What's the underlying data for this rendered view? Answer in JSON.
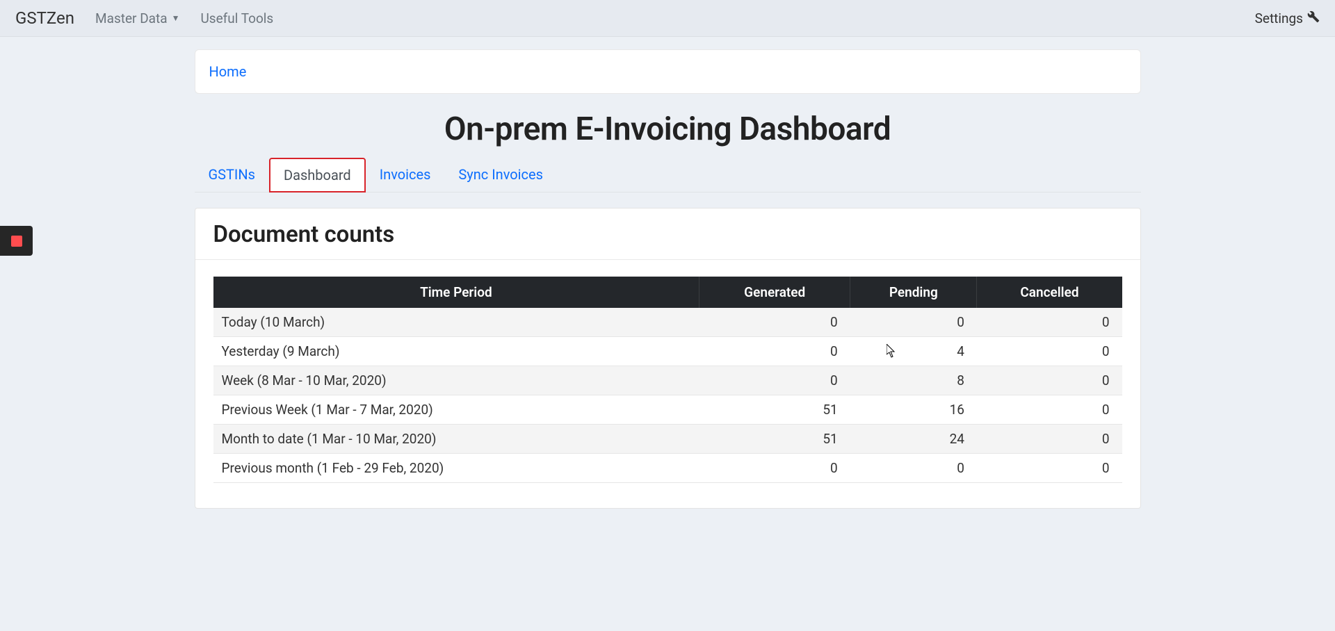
{
  "navbar": {
    "brand": "GSTZen",
    "master_data_label": "Master Data",
    "useful_tools_label": "Useful Tools",
    "settings_label": "Settings"
  },
  "breadcrumb": {
    "home": "Home"
  },
  "page_title": "On-prem E-Invoicing Dashboard",
  "tabs": [
    {
      "label": "GSTINs"
    },
    {
      "label": "Dashboard"
    },
    {
      "label": "Invoices"
    },
    {
      "label": "Sync Invoices"
    }
  ],
  "active_tab_index": 1,
  "card_title": "Document counts",
  "table": {
    "headers": [
      "Time Period",
      "Generated",
      "Pending",
      "Cancelled"
    ],
    "rows": [
      {
        "period": "Today (10 March)",
        "generated": "0",
        "pending": "0",
        "cancelled": "0"
      },
      {
        "period": "Yesterday (9 March)",
        "generated": "0",
        "pending": "4",
        "cancelled": "0"
      },
      {
        "period": "Week (8 Mar - 10 Mar, 2020)",
        "generated": "0",
        "pending": "8",
        "cancelled": "0"
      },
      {
        "period": "Previous Week (1 Mar - 7 Mar, 2020)",
        "generated": "51",
        "pending": "16",
        "cancelled": "0"
      },
      {
        "period": "Month to date (1 Mar - 10 Mar, 2020)",
        "generated": "51",
        "pending": "24",
        "cancelled": "0"
      },
      {
        "period": "Previous month (1 Feb - 29 Feb, 2020)",
        "generated": "0",
        "pending": "0",
        "cancelled": "0"
      }
    ]
  }
}
